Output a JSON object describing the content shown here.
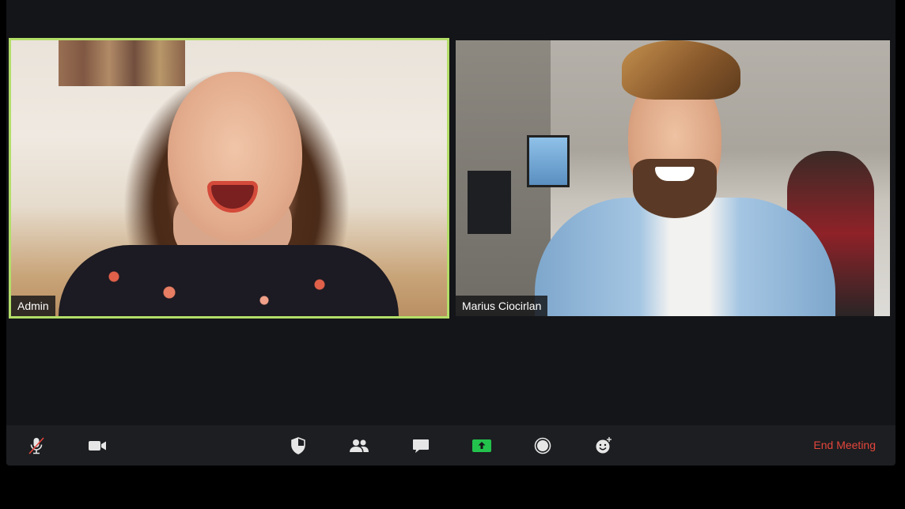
{
  "participants": [
    {
      "name": "Admin",
      "active_speaker": true
    },
    {
      "name": "Marius Ciocirlan",
      "active_speaker": false
    }
  ],
  "toolbar": {
    "buttons": [
      {
        "icon": "microphone-muted-icon"
      },
      {
        "icon": "video-camera-icon"
      },
      {
        "icon": "security-shield-icon"
      },
      {
        "icon": "participants-icon"
      },
      {
        "icon": "chat-icon"
      },
      {
        "icon": "share-screen-icon"
      },
      {
        "icon": "record-icon"
      },
      {
        "icon": "reactions-icon"
      }
    ],
    "end_meeting_label": "End Meeting"
  },
  "colors": {
    "active_speaker_border": "#b3de68",
    "share_screen_green": "#23c24d",
    "end_meeting_red": "#e5453c",
    "mute_slash_red": "#e5453c",
    "background": "#141518",
    "toolbar": "#1c1e21"
  }
}
